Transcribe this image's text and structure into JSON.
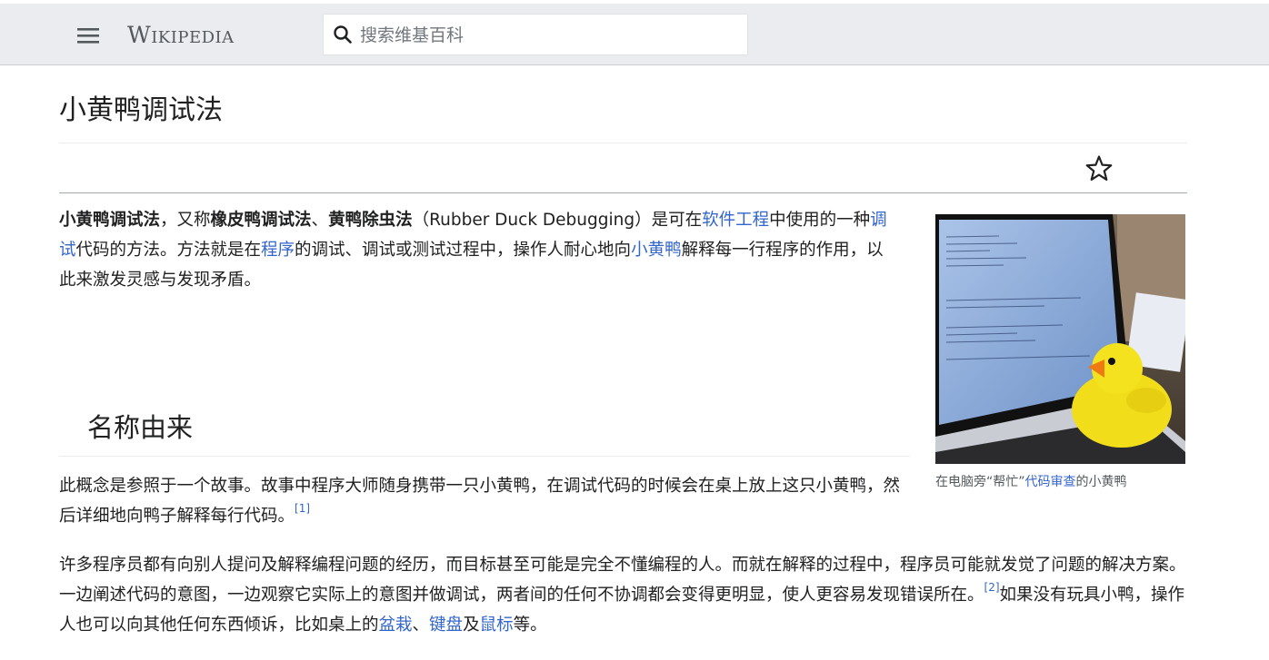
{
  "header": {
    "menu_icon": "hamburger-menu-icon",
    "logo_text": "Wikipedia",
    "search_placeholder": "搜索维基百科",
    "search_icon": "search-icon"
  },
  "article": {
    "title": "小黄鸭调试法",
    "watch_icon": "star-icon",
    "intro": {
      "t1": "小黄鸭调试法",
      "t2": "，又称",
      "t3": "橡皮鸭调试法",
      "t4": "、",
      "t5": "黄鸭除虫法",
      "t6": "（Rubber Duck Debugging）是可在",
      "l1": "软件工程",
      "t7": "中使用的一种",
      "l2": "调试",
      "t8": "代码的方法。方法就是在",
      "l3": "程序",
      "t9": "的调试、调试或测试过程中，操作人耐心地向",
      "l4": "小黄鸭",
      "t10": "解释每一行程序的作用，以此来激发灵感与发现矛盾。"
    },
    "figure": {
      "caption_pre": "在电脑旁“帮忙”",
      "caption_link": "代码审查",
      "caption_post": "的小黄鸭"
    },
    "section_title": "名称由来",
    "para1": {
      "text": "此概念是参照于一个故事。故事中程序大师随身携带一只小黄鸭，在调试代码的时候会在桌上放上这只小黄鸭，然后详细地向鸭子解释每行代码。",
      "ref": "[1]"
    },
    "para2": {
      "t1": "许多程序员都有向别人提问及解释编程问题的经历，而目标甚至可能是完全不懂编程的人。而就在解释的过程中，程序员可能就发觉了问题的解决方案。一边阐述代码的意图，一边观察它实际上的意图并做调试，两者间的任何不协调都会变得更明显，使人更容易发现错误所在。",
      "ref": "[2]",
      "t2": "如果没有玩具小鸭，操作人也可以向其他任何东西倾诉，比如桌上的",
      "l1": "盆栽",
      "t3": "、",
      "l2": "键盘",
      "t4": "及",
      "l3": "鼠标",
      "t5": "等。"
    }
  }
}
